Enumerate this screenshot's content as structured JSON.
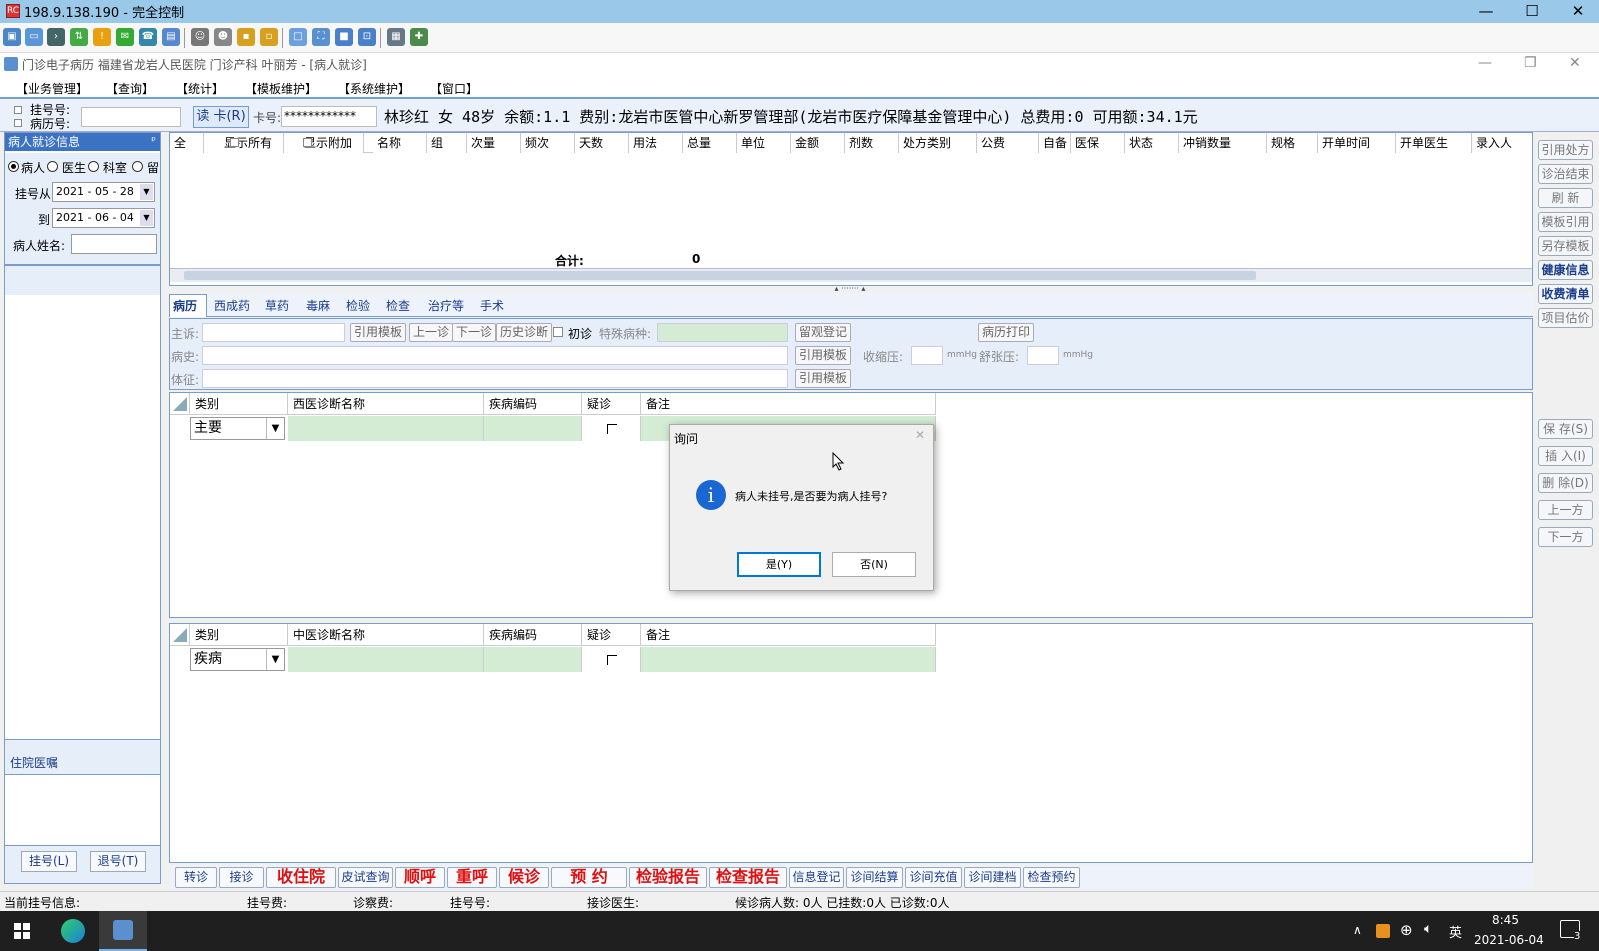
{
  "remote_window": {
    "title": "198.9.138.190 - 完全控制",
    "app_icon": "RC",
    "min": "—",
    "max": "☐",
    "close": "✕"
  },
  "toolbar_icons": [
    "monitor-icon",
    "screen-icon",
    "terminal-icon",
    "transfer-icon",
    "alert-icon",
    "chat-icon",
    "phone-icon",
    "message-icon",
    "user-icon",
    "users-icon",
    "lock-icon",
    "unlock-icon",
    "window-icon",
    "fullscreen-icon",
    "fit-icon",
    "scale-icon",
    "screenshot-icon",
    "tools-icon"
  ],
  "app_title": {
    "text": "门诊电子病历  福建省龙岩人民医院  门诊产科  叶丽芳 - [病人就诊]",
    "min": "—",
    "restore": "❐",
    "close": "✕"
  },
  "menu": [
    "【业务管理】",
    "【查询】",
    "【统计】",
    "【模板维护】",
    "【系统维护】",
    "【窗口】"
  ],
  "infobar": {
    "reg_no_label": "挂号号:",
    "record_no_label": "病历号:",
    "read_card": "读 卡(R)",
    "card_no_label": "卡号:",
    "card_no_value": "************",
    "patient_info": "林珍红  女  48岁  余额:1.1  费别:龙岩市医管中心新罗管理部(龙岩市医疗保障基金管理中心) 总费用:0  可用额:34.1元"
  },
  "left_panel": {
    "title": "病人就诊信息",
    "pin": "ᵖ",
    "radios": [
      "病人",
      "医生",
      "科室",
      "留"
    ],
    "from_label": "挂号从",
    "from_value": "2021 - 05 - 28",
    "to_label": "到",
    "to_value": "2021 - 06 - 04",
    "name_label": "病人姓名:",
    "inpatient_title": "住院医嘱",
    "reg_button": "挂号(L)",
    "unreg_button": "退号(T)"
  },
  "rx_grid": {
    "headers": [
      "全",
      "显示所有",
      "显示附加",
      "名称",
      "组",
      "次量",
      "频次",
      "天数",
      "用法",
      "总量",
      "单位",
      "金额",
      "剂数",
      "处方类别",
      "公费",
      "自备",
      "医保",
      "状态",
      "冲销数量",
      "规格",
      "开单时间",
      "开单医生",
      "录入人"
    ],
    "total_label": "合计:",
    "total_value": "0"
  },
  "side_buttons": [
    "引用处方",
    "诊治结束",
    "刷 新",
    "模板引用",
    "另存模板",
    "健康信息",
    "收费清单",
    "项目估价"
  ],
  "side_buttons2": [
    "保 存(S)",
    "插 入(I)",
    "删 除(D)",
    "上一方",
    "下一方"
  ],
  "tabs": [
    "病历",
    "西成药",
    "草药",
    "毒麻",
    "检验",
    "检查",
    "治疗等",
    "手术"
  ],
  "emr": {
    "chief_label": "主诉:",
    "ref_template": "引用模板",
    "prev_visit": "上一诊",
    "next_visit": "下一诊",
    "history_diag": "历史诊断",
    "first_visit": "初诊",
    "special_label": "特殊病种:",
    "observe": "留观登记",
    "print": "病历打印",
    "history_label": "病史:",
    "systolic_label": "收缩压:",
    "diastolic_label": "舒张压:",
    "unit": "mmHg",
    "sign_label": "体征:"
  },
  "wm_grid": {
    "headers": [
      "类别",
      "西医诊断名称",
      "疾病编码",
      "疑诊",
      "备注"
    ],
    "type_value": "主要"
  },
  "tcm_grid": {
    "headers": [
      "类别",
      "中医诊断名称",
      "疾病编码",
      "疑诊",
      "备注"
    ],
    "type_value": "疾病"
  },
  "dialog": {
    "title": "询问",
    "message": "病人未挂号,是否要为病人挂号?",
    "yes": "是(Y)",
    "no": "否(N)",
    "close": "✕",
    "icon": "i"
  },
  "bottom_buttons": [
    "转诊",
    "接诊",
    "收住院",
    "皮试查询",
    "顺呼",
    "重呼",
    "候诊",
    "预  约",
    "检验报告",
    "检查报告",
    "信息登记",
    "诊间结算",
    "诊间充值",
    "诊间建档",
    "检查预约"
  ],
  "status": {
    "current": "当前挂号信息:",
    "reg_fee": "挂号费:",
    "exam_fee": "诊察费:",
    "reg_no": "挂号号:",
    "doctor": "接诊医生:",
    "counts": "候诊病人数: 0人  已挂数:0人  已诊数:0人"
  },
  "taskbar": {
    "time": "8:45",
    "date": "2021-06-04",
    "lang": "英",
    "notif": "3"
  },
  "colors": {
    "accent": "#3c72c4",
    "remote_title": "#99c8e8",
    "red_button": "#e01010",
    "green_cell": "#d4ecd4"
  }
}
